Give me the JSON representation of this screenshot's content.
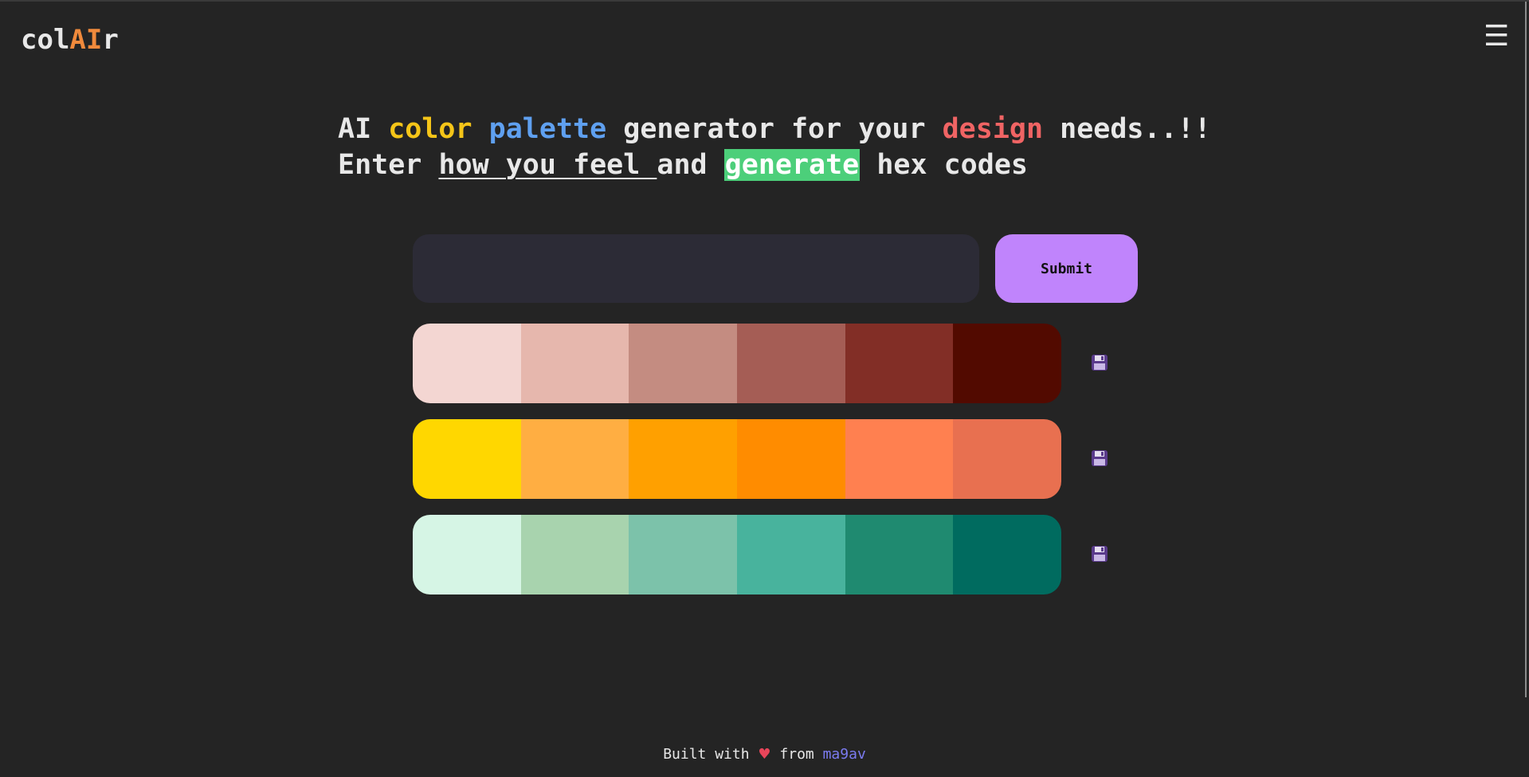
{
  "logo": {
    "prefix": "col",
    "highlight": "AI",
    "suffix": "r"
  },
  "menu": {
    "icon": "hamburger-menu-icon",
    "glyph": "☰"
  },
  "hero": {
    "line1": [
      "AI ",
      "color",
      " ",
      "palette",
      " generator for your ",
      "design",
      " needs..!!"
    ],
    "line2": [
      "Enter ",
      "how you feel ",
      "and ",
      "generate",
      " hex codes"
    ]
  },
  "colors": {
    "background": "#242424",
    "accent_color_word": "#f5c518",
    "accent_palette_word": "#5fa0f0",
    "accent_design_word": "#f06464",
    "accent_generate_bg": "#4ccf7a",
    "submit_bg": "#c084fc",
    "logo_ai": "#f08a3c"
  },
  "input": {
    "value": "",
    "placeholder": ""
  },
  "submit": {
    "label": "Submit"
  },
  "palettes": [
    {
      "swatches": [
        "#f3d6d2",
        "#e6b7ad",
        "#c48c81",
        "#a55d55",
        "#822e26",
        "#520a00"
      ],
      "save_icon": "floppy-disk-icon"
    },
    {
      "swatches": [
        "#ffd700",
        "#ffae42",
        "#ffa000",
        "#ff8c00",
        "#ff8050",
        "#e87050"
      ],
      "save_icon": "floppy-disk-icon"
    },
    {
      "swatches": [
        "#d6f5e5",
        "#a8d3ae",
        "#7cc2aa",
        "#48b39d",
        "#1f8a70",
        "#006b5f"
      ],
      "save_icon": "floppy-disk-icon"
    }
  ],
  "footer": {
    "prefix": "Built with ",
    "heart": "♥",
    "middle": " from ",
    "author": "ma9av"
  }
}
